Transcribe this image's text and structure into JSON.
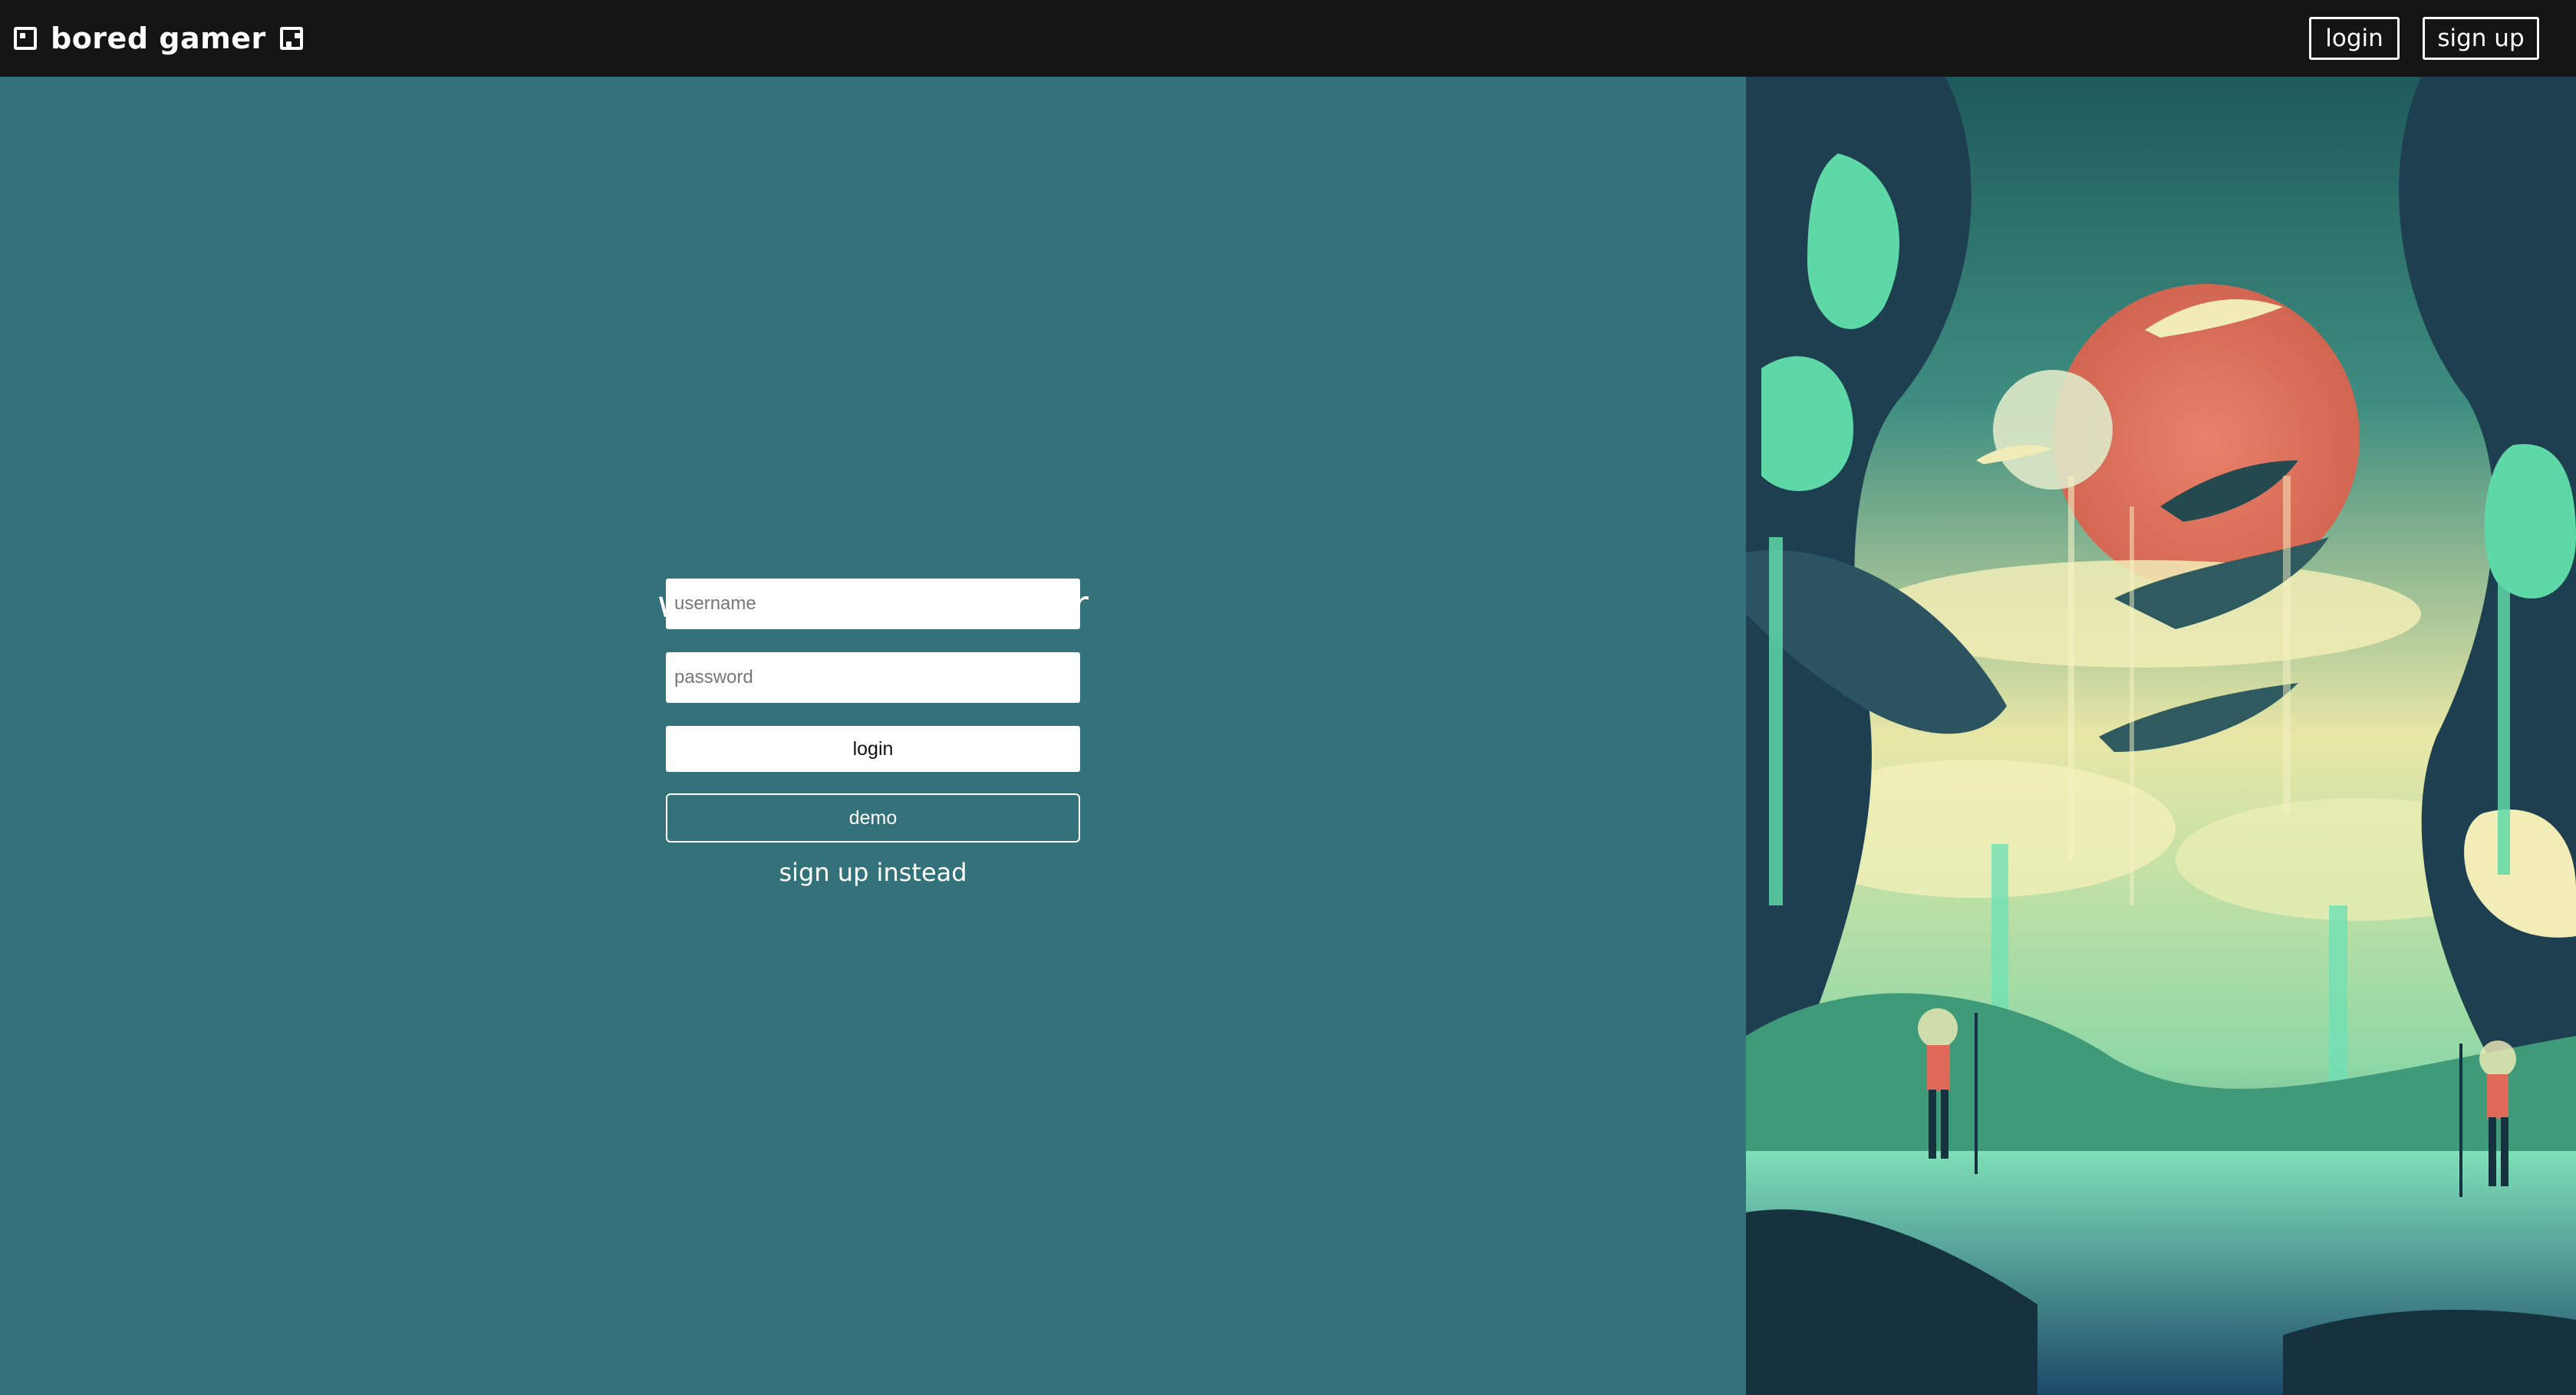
{
  "brand": {
    "name": "bored gamer"
  },
  "nav": {
    "login_label": "login",
    "signup_label": "sign up"
  },
  "login_form": {
    "heading": "welcome back stranger",
    "username_placeholder": "username",
    "password_placeholder": "password",
    "login_label": "login",
    "demo_label": "demo",
    "signup_link": "sign up instead"
  },
  "colors": {
    "topbar": "#141414",
    "panel": "#33727a",
    "accent_red": "#e06a5a",
    "mint": "#5fd8a8"
  },
  "icons": [
    "die-one-icon",
    "die-two-icon"
  ]
}
